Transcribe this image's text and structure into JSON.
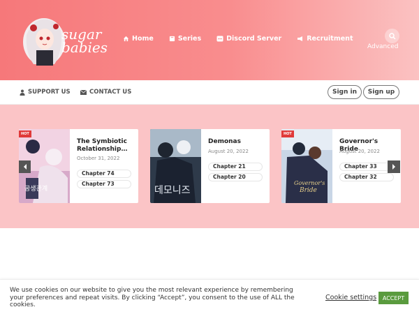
{
  "header": {
    "logo_text": "sugar babies",
    "logo_line1": "sugar",
    "logo_line2": "babies",
    "nav": [
      {
        "label": "Home",
        "icon": "home-icon"
      },
      {
        "label": "Series",
        "icon": "book-icon"
      },
      {
        "label": "Discord Server",
        "icon": "discord-icon"
      },
      {
        "label": "Recruitment",
        "icon": "megaphone-icon"
      }
    ],
    "advanced_label": "Advanced"
  },
  "subbar": {
    "support_label": "SUPPORT US",
    "contact_label": "CONTACT US",
    "signin_label": "Sign in",
    "signup_label": "Sign up"
  },
  "cards": [
    {
      "title": "The Symbiotic Relationship…",
      "date": "October 31, 2022",
      "hot": "HOT",
      "chapters": [
        "Chapter 74",
        "Chapter 73"
      ]
    },
    {
      "title": "Demonas",
      "date": "August 20, 2022",
      "hot": "",
      "chapters": [
        "Chapter 21",
        "Chapter 20"
      ]
    },
    {
      "title": "Governor's Bride",
      "date": "August 20, 2022",
      "hot": "HOT",
      "chapters": [
        "Chapter 33",
        "Chapter 32"
      ]
    }
  ],
  "cookie": {
    "text": "We use cookies on our website to give you the most relevant experience by remembering your preferences and repeat visits. By clicking “Accept”, you consent to the use of ALL the cookies.",
    "settings_label": "Cookie settings",
    "accept_label": "ACCEPT"
  },
  "colors": {
    "header_start": "#f6787a",
    "slider_bg": "#fbc4c6",
    "accept_green": "#5a9b3e",
    "hot_red": "#e03a3a"
  }
}
